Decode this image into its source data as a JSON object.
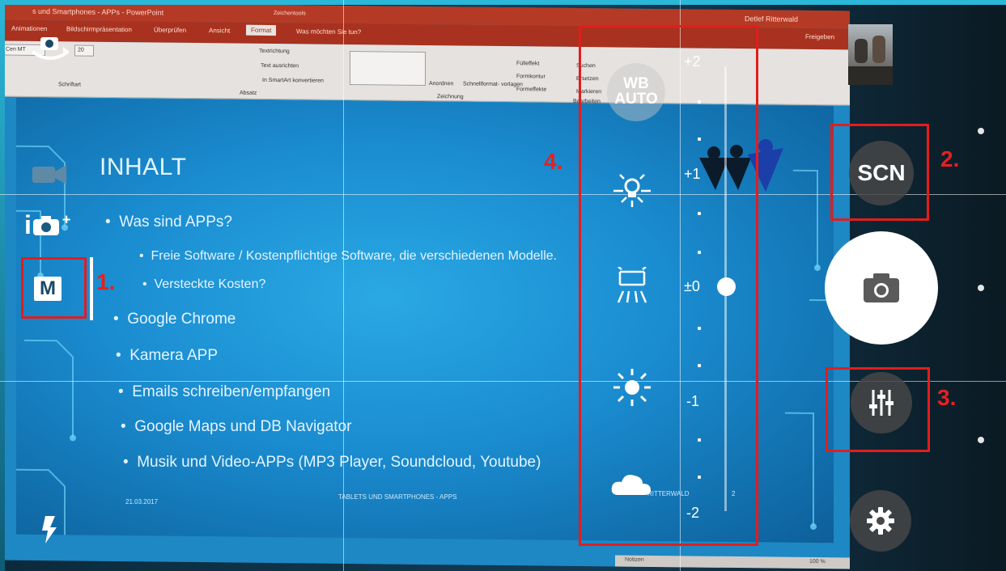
{
  "ppt": {
    "window_title": "s und Smartphones - APPs - PowerPoint",
    "context_tab": "Zeichentools",
    "user": "Detlef Ritterwald",
    "share": "Freigeben",
    "tabs": [
      "Animationen",
      "Bildschirmpräsentation",
      "Überprüfen",
      "Ansicht",
      "Format"
    ],
    "tell_me": "Was möchten Sie tun?",
    "ribbon": {
      "font_name": "Cen MT",
      "font_size": "20",
      "group_schriftart": "Schriftart",
      "group_absatz": "Absatz",
      "group_zeichnung": "Zeichnung",
      "group_bearbeiten": "Bearbeiten",
      "textrichtung": "Textrichtung",
      "text_ausrichten": "Text ausrichten",
      "smartart": "In SmartArt konvertieren",
      "anordnen": "Anordnen",
      "schnellformat": "Schnellformat-\nvorlagen",
      "fuelleffekt": "Fülleffekt",
      "formkontur": "Formkontur",
      "formeffekte": "Formeffekte",
      "suchen": "Suchen",
      "ersetzen": "Ersetzen",
      "markieren": "Markieren"
    },
    "status_notes": "Notizen",
    "status_zoom": "100 %"
  },
  "slide": {
    "title": "INHALT",
    "bullets": [
      {
        "text": "Was sind APPs?",
        "level": 1
      },
      {
        "text": "Freie Software / Kostenpflichtige Software, die verschiedenen Modelle.",
        "level": 2
      },
      {
        "text": "Versteckte Kosten?",
        "level": 2
      },
      {
        "text": "Google Chrome",
        "level": 1
      },
      {
        "text": "Kamera APP",
        "level": 1
      },
      {
        "text": "Emails schreiben/empfangen",
        "level": 1
      },
      {
        "text": "Google Maps und DB Navigator",
        "level": 1
      },
      {
        "text": "Musik und Video-APPs (MP3 Player, Soundcloud, Youtube)",
        "level": 1
      }
    ],
    "footer_date": "21.03.2017",
    "footer_center": "TABLETS UND SMARTPHONES - APPS",
    "footer_right": "RITTERWALD",
    "page_number": "2"
  },
  "camera": {
    "mode_label": "M",
    "iplus": "i",
    "scn_label": "SCN",
    "wb_label_line1": "WB",
    "wb_label_line2": "AUTO",
    "ev_labels": {
      "p2": "+2",
      "p1": "+1",
      "zero": "±0",
      "m1": "-1",
      "m2": "-2"
    },
    "exposure_value": 0
  },
  "annotations": {
    "n1": "1.",
    "n2": "2.",
    "n3": "3.",
    "n4": "4.",
    "color": "#e21d1d"
  }
}
